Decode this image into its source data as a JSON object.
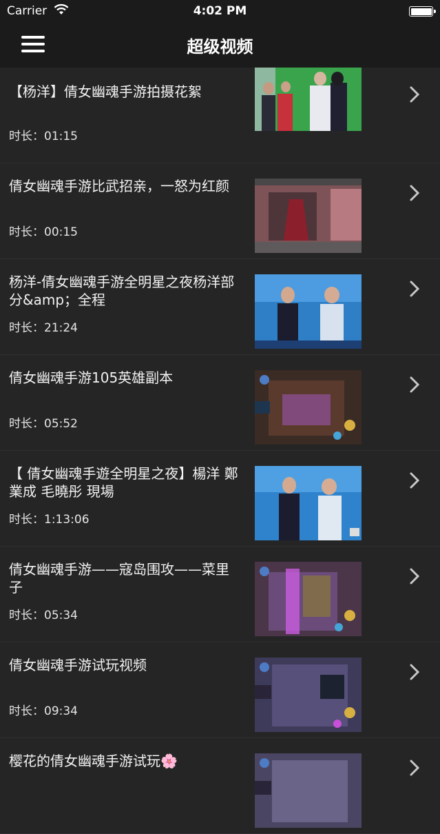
{
  "status_bar": {
    "carrier": "Carrier",
    "time": "4:02 PM"
  },
  "nav": {
    "title": "超级视频",
    "menu_icon": "hamburger-menu-icon"
  },
  "videos": [
    {
      "title": "【杨洋】倩女幽魂手游拍摄花絮",
      "duration": "时长：01:15",
      "thumb": "green"
    },
    {
      "title": "倩女幽魂手游比武招亲，一怒为红颜",
      "duration": "时长：00:15",
      "thumb": "red"
    },
    {
      "title": "杨洋-倩女幽魂手游全明星之夜杨洋部分&amp；全程",
      "duration": "时长：21:24",
      "thumb": "stage"
    },
    {
      "title": "倩女幽魂手游105英雄副本",
      "duration": "时长：05:52",
      "thumb": "game"
    },
    {
      "title": "【 倩女幽魂手遊全明星之夜】楊洋 鄭業成 毛曉彤 現場",
      "duration": "时长：1:13:06",
      "thumb": "stage"
    },
    {
      "title": "倩女幽魂手游——寇岛围攻——菜里子",
      "duration": "时长：05:34",
      "thumb": "game2"
    },
    {
      "title": "倩女幽魂手游试玩视频",
      "duration": "时长：09:34",
      "thumb": "game3"
    },
    {
      "title": "樱花的倩女幽魂手游试玩🌸",
      "duration": "",
      "thumb": "game3"
    }
  ]
}
